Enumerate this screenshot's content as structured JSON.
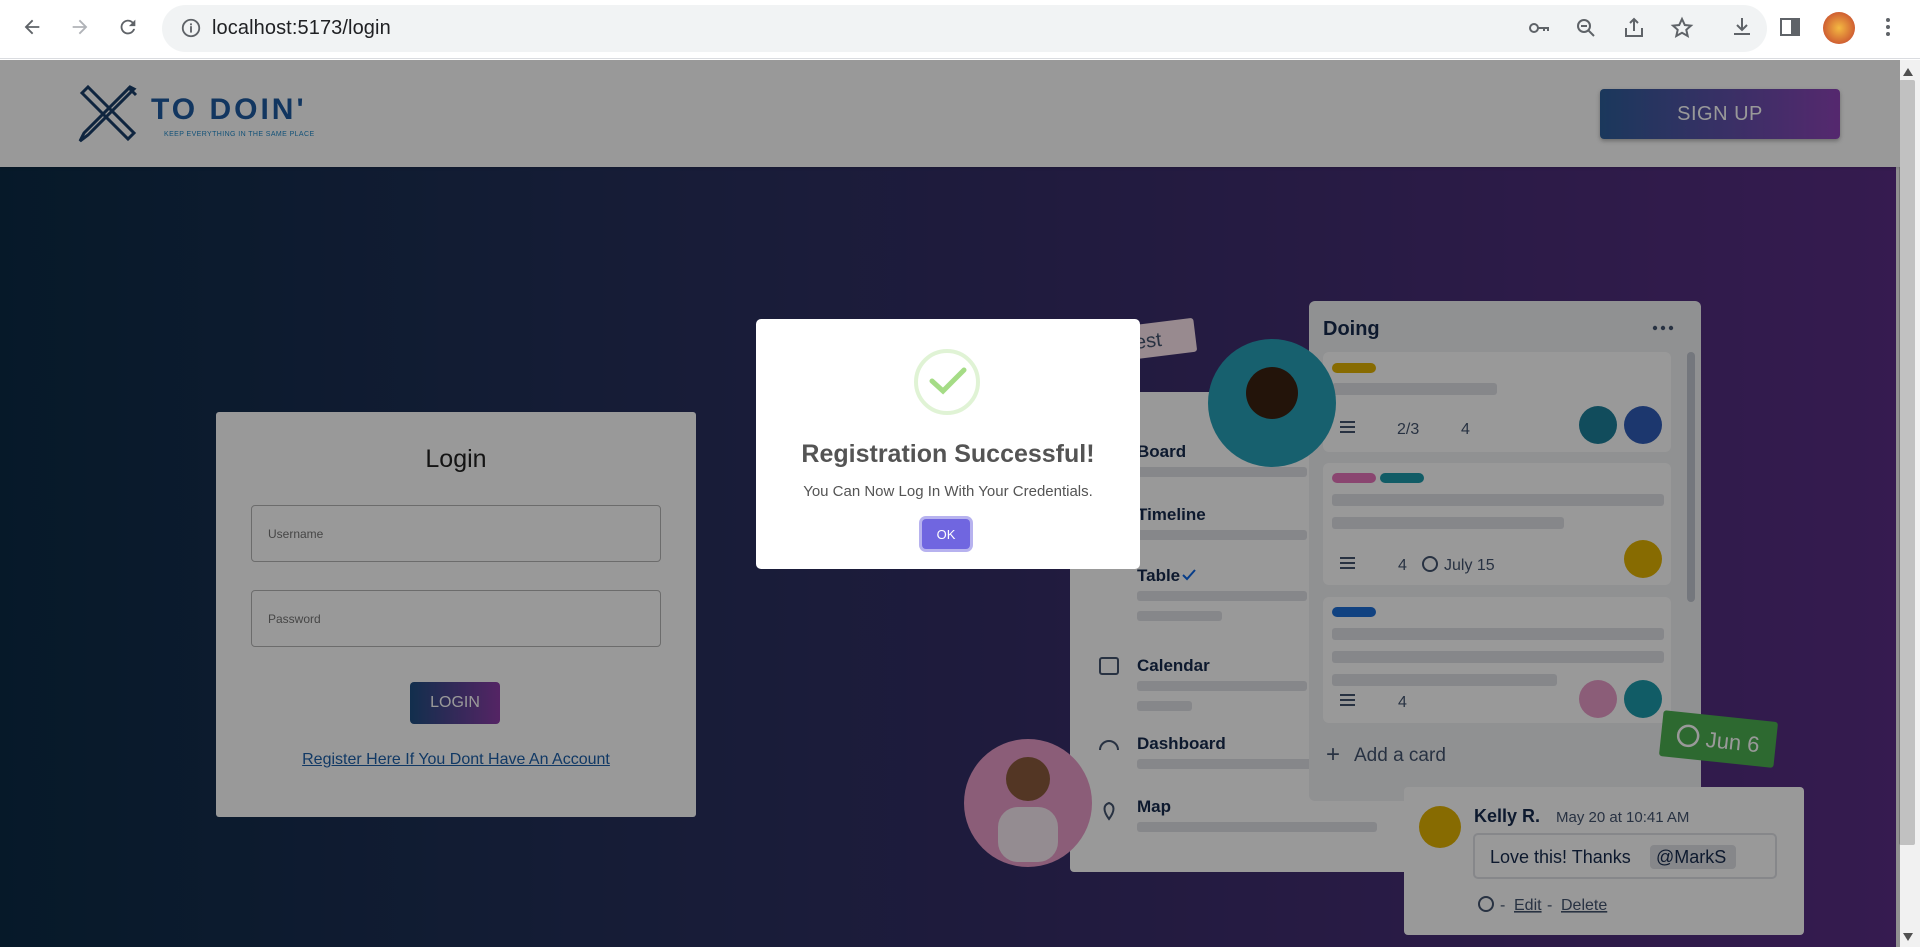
{
  "browser": {
    "url": "localhost:5173/login"
  },
  "header": {
    "logo_title": "TO DOIN'",
    "logo_tagline": "KEEP EVERYTHING IN THE SAME PLACE",
    "signup_label": "SIGN UP"
  },
  "login": {
    "title": "Login",
    "username_placeholder": "Username",
    "password_placeholder": "Password",
    "login_label": "LOGIN",
    "register_link": "Register Here If You Dont Have An Account"
  },
  "illustration": {
    "copy_request": "Copy request",
    "doing_title": "Doing",
    "card1_checklist": "2/3",
    "card1_attachments": "4",
    "card2_attachments": "4",
    "card2_date": "July 15",
    "card3_attachments": "4",
    "add_card": "Add a card",
    "due_badge": "Jun 6",
    "views": [
      "Board",
      "Timeline",
      "Table",
      "Calendar",
      "Dashboard",
      "Map"
    ],
    "comment": {
      "author": "Kelly R.",
      "time": "May 20 at 10:41 AM",
      "text": "Love this! Thanks",
      "mention": "@MarkS",
      "edit": "Edit",
      "delete": "Delete"
    }
  },
  "dialog": {
    "title": "Registration Successful!",
    "message": "You Can Now Log In With Your Credentials.",
    "ok_label": "OK"
  },
  "colors": {
    "accent": "#7066e0",
    "success": "#a5dc86",
    "hero_start": "#0b2b45",
    "hero_end": "#5a2e85"
  }
}
